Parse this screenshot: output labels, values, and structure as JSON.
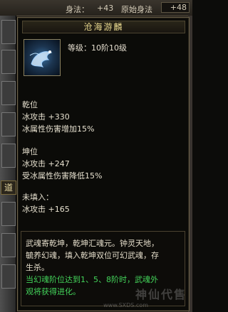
{
  "top_stats": {
    "label": "身法：",
    "value": "+43",
    "base_label": "原始身法",
    "base_value": "+48"
  },
  "left_tag": "道",
  "tooltip": {
    "title": "沧海游麟",
    "icon_name": "dragon-soul-icon",
    "grade": "等级：10阶10级",
    "sections": [
      {
        "head": "乾位",
        "lines": [
          "冰攻击 +330",
          "冰属性伤害增加15%"
        ]
      },
      {
        "head": "坤位",
        "lines": [
          "冰攻击 +247",
          "受冰属性伤害降低15%"
        ]
      },
      {
        "head": "未填入：",
        "lines": [
          "冰攻击 +165"
        ]
      }
    ],
    "desc": {
      "line1": "武魂寄乾坤，乾坤汇魂元。钟灵天地，",
      "line2": "毓养幻魂，填入乾坤双位可幻武魂，存",
      "line3": "生杀。",
      "green1": "当幻魂阶位达到1、5、8阶时，武魂外",
      "green2": "观将获得进化。"
    }
  },
  "watermark": {
    "text": "神仙代售",
    "url": "www.SXDS.com"
  },
  "colors": {
    "title": "#e9d98f",
    "text": "#e3dcc9",
    "green": "#43d45a",
    "border": "#6a6048"
  }
}
